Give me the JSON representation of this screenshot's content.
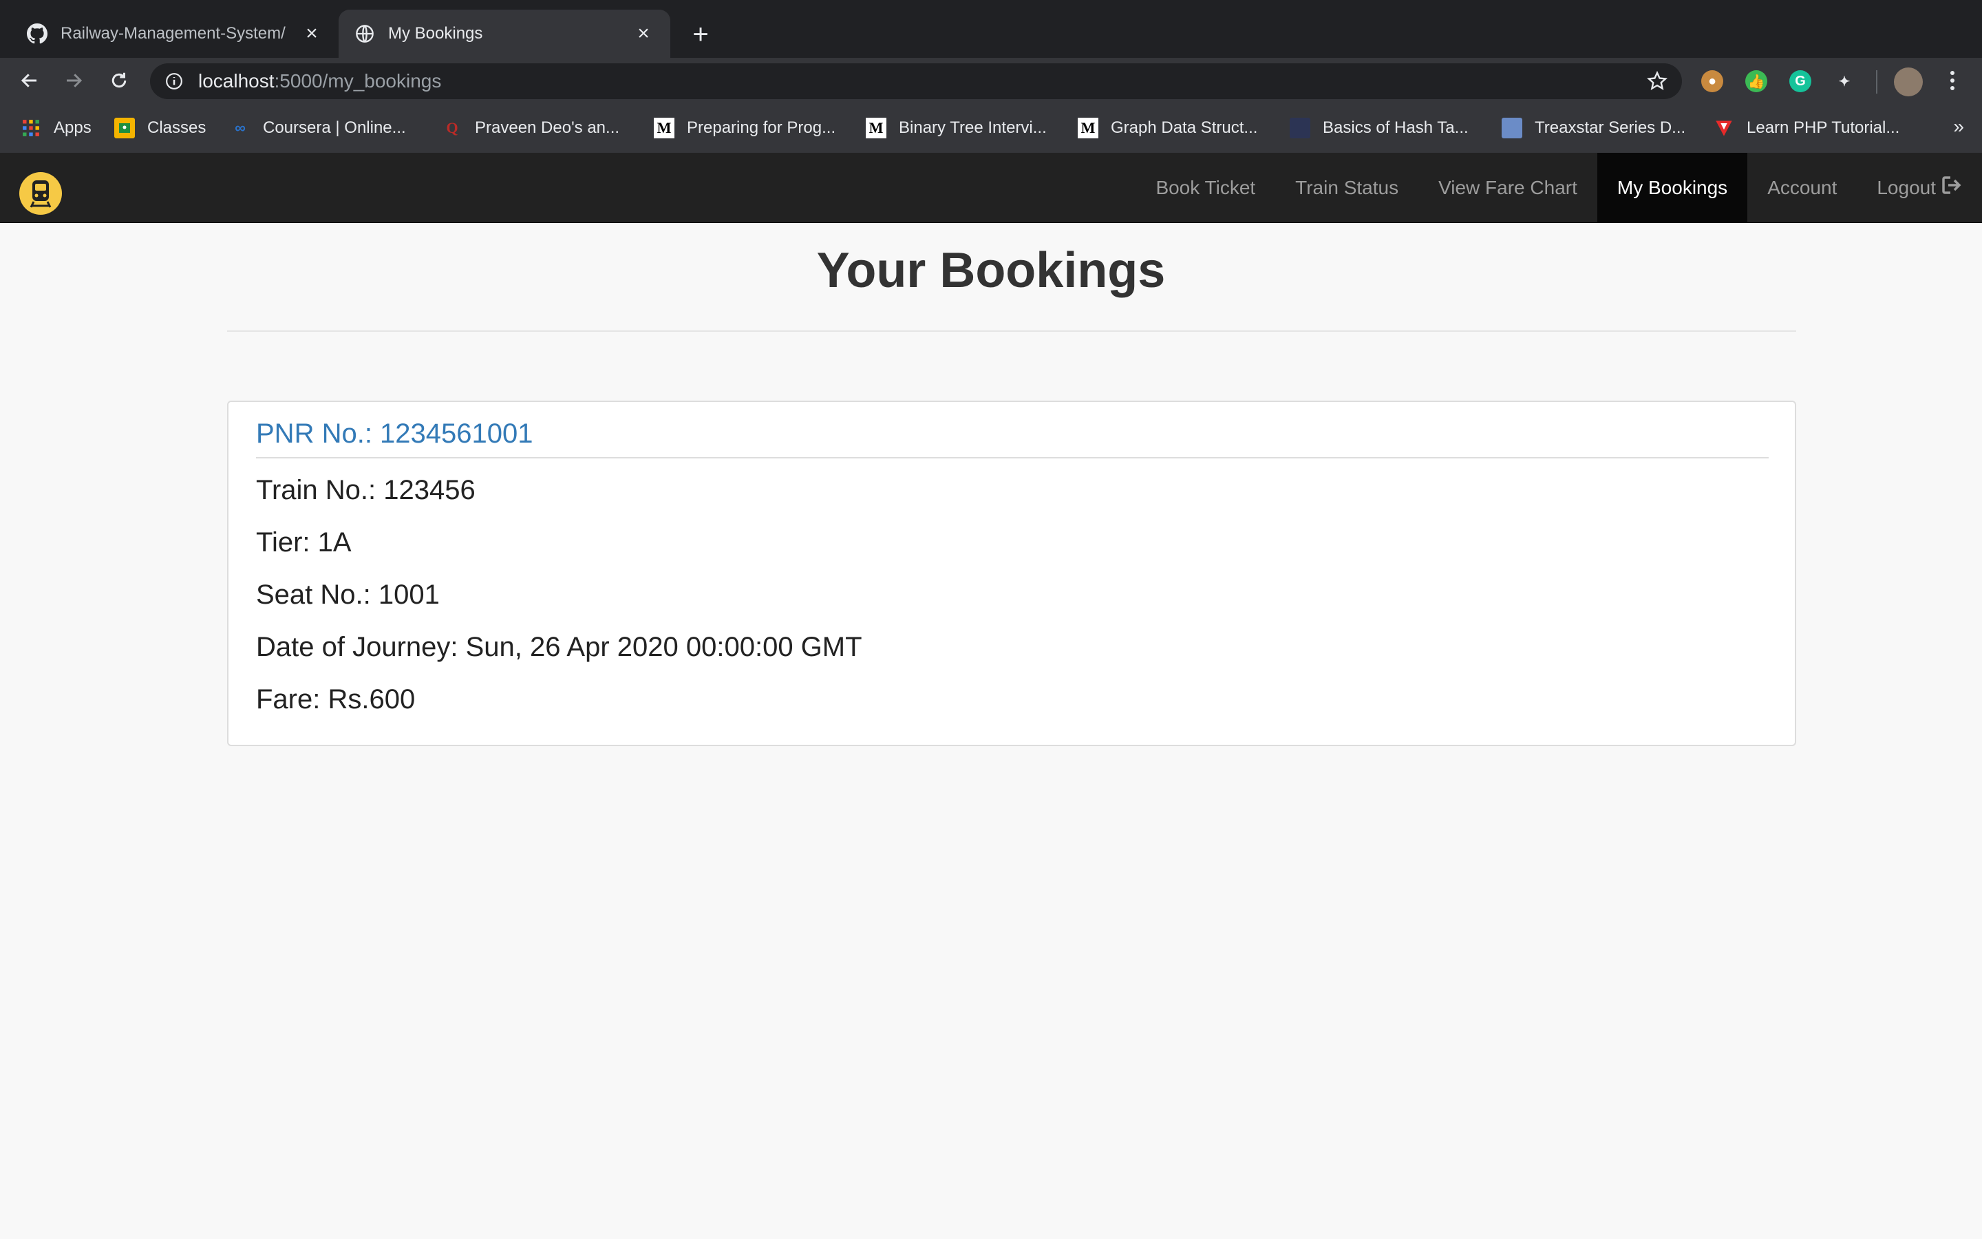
{
  "browser": {
    "tabs": [
      {
        "title": "Railway-Management-System/",
        "favicon": "github-icon",
        "active": false
      },
      {
        "title": "My Bookings",
        "favicon": "globe-icon",
        "active": true
      }
    ],
    "url_host": "localhost",
    "url_path": ":5000/my_bookings",
    "bookmarks": [
      {
        "label": "Apps",
        "icon": "apps-grid-icon"
      },
      {
        "label": "Classes",
        "icon": "classroom-icon"
      },
      {
        "label": "Coursera | Online...",
        "icon": "coursera-icon"
      },
      {
        "label": "Praveen Deo's an...",
        "icon": "quora-icon"
      },
      {
        "label": "Preparing for Prog...",
        "icon": "medium-icon"
      },
      {
        "label": "Binary Tree Intervi...",
        "icon": "medium-icon"
      },
      {
        "label": "Graph Data Struct...",
        "icon": "medium-icon"
      },
      {
        "label": "Basics of Hash Ta...",
        "icon": "hackerearth-icon"
      },
      {
        "label": "Treaxstar Series D...",
        "icon": "bookmark-image-icon"
      },
      {
        "label": "Learn PHP Tutorial...",
        "icon": "vivaldi-icon"
      }
    ],
    "more_bookmarks": "»"
  },
  "navbar": {
    "brand_icon": "train-logo-icon",
    "links": [
      {
        "label": "Book Ticket",
        "active": false
      },
      {
        "label": "Train Status",
        "active": false
      },
      {
        "label": "View Fare Chart",
        "active": false
      },
      {
        "label": "My Bookings",
        "active": true
      },
      {
        "label": "Account",
        "active": false
      },
      {
        "label": "Logout",
        "active": false,
        "icon": "logout-icon"
      }
    ]
  },
  "page": {
    "title": "Your Bookings",
    "bookings": [
      {
        "pnr": "PNR No.: 1234561001",
        "train_no": "Train No.: 123456",
        "tier": "Tier: 1A",
        "seat_no": "Seat No.: 1001",
        "date": "Date of Journey: Sun, 26 Apr 2020 00:00:00 GMT",
        "fare": "Fare: Rs.600"
      }
    ]
  },
  "colors": {
    "navbar_bg": "#222222",
    "navbar_active_bg": "#080808",
    "link_blue": "#337ab7",
    "brand_yellow": "#f6c945"
  }
}
